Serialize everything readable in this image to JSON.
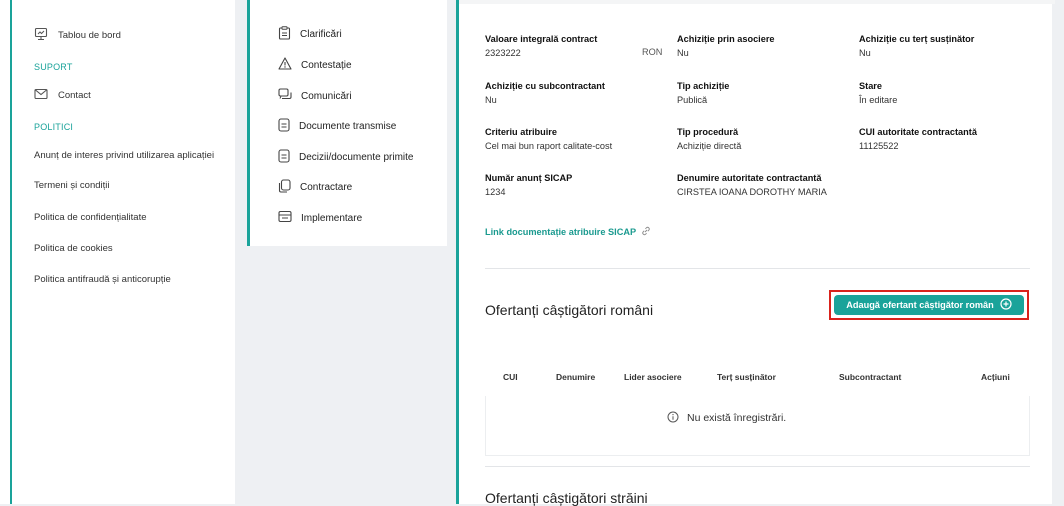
{
  "sidebar": {
    "dashboard_label": "Tablou de bord",
    "support_heading": "SUPORT",
    "contact_label": "Contact",
    "policies_heading": "POLITICI",
    "links": [
      "Anunț de interes privind utilizarea aplicației",
      "Termeni și condiții",
      "Politica de confidențialitate",
      "Politica de cookies",
      "Politica antifraudă și anticorupție"
    ]
  },
  "menu": {
    "items": [
      "Clarificări",
      "Contestație",
      "Comunicări",
      "Documente transmise",
      "Decizii/documente primite",
      "Contractare",
      "Implementare"
    ]
  },
  "details": {
    "valoare_label": "Valoare integrală contract",
    "valoare_value": "2323222",
    "valoare_currency": "RON",
    "asociere_label": "Achiziție prin asociere",
    "asociere_value": "Nu",
    "tert_label": "Achiziție cu terț susținător",
    "tert_value": "Nu",
    "subcontractant_label": "Achiziție cu subcontractant",
    "subcontractant_value": "Nu",
    "tip_achizitie_label": "Tip achiziție",
    "tip_achizitie_value": "Publică",
    "stare_label": "Stare",
    "stare_value": "În editare",
    "criteriu_label": "Criteriu atribuire",
    "criteriu_value": "Cel mai bun raport calitate-cost",
    "procedura_label": "Tip procedură",
    "procedura_value": "Achiziție directă",
    "cui_label": "CUI autoritate contractantă",
    "cui_value": "11125522",
    "anunt_label": "Număr anunț SICAP",
    "anunt_value": "1234",
    "denumire_label": "Denumire autoritate contractantă",
    "denumire_value": "CIRSTEA IOANA DOROTHY MARIA",
    "sicap_link": "Link documentație atribuire SICAP"
  },
  "winners_ro": {
    "title": "Ofertanți câștigători români",
    "add_button": "Adaugă ofertant câștigător român",
    "columns": [
      "CUI",
      "Denumire",
      "Lider asociere",
      "Terț susținător",
      "Subcontractant",
      "Acțiuni"
    ],
    "empty_message": "Nu există înregistrări."
  },
  "winners_foreign": {
    "title": "Ofertanți câștigători străini"
  },
  "colors": {
    "accent": "#1aa39a",
    "highlight": "#d9231d"
  }
}
